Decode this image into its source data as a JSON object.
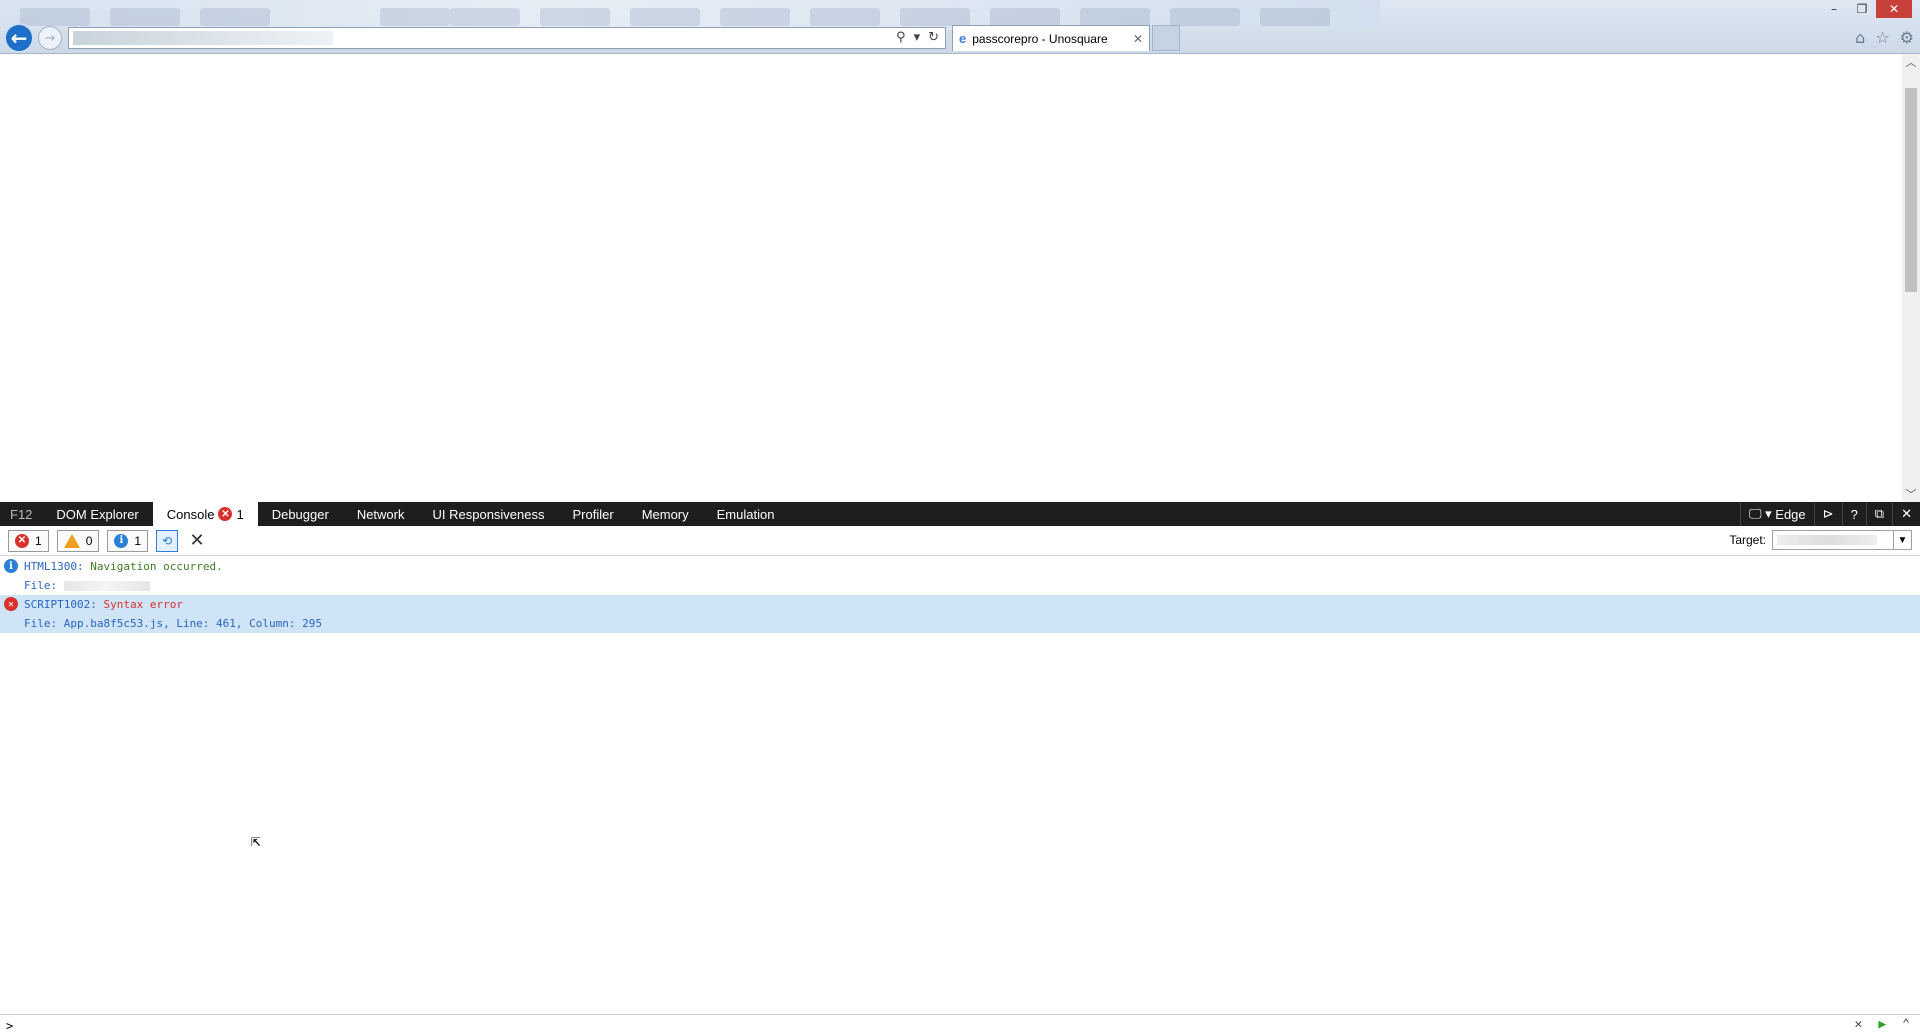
{
  "browser": {
    "tab_title": "passcorepro - Unosquare",
    "window_controls": {
      "minimize": "–",
      "restore": "❐",
      "close": "✕"
    }
  },
  "devtools": {
    "f12_label": "F12",
    "tools": [
      {
        "label": "DOM Explorer"
      },
      {
        "label": "Console",
        "badge": "1"
      },
      {
        "label": "Debugger"
      },
      {
        "label": "Network"
      },
      {
        "label": "UI Responsiveness"
      },
      {
        "label": "Profiler"
      },
      {
        "label": "Memory"
      },
      {
        "label": "Emulation"
      }
    ],
    "mode_label": "Edge",
    "help_label": "?"
  },
  "console": {
    "filters": {
      "errors": "1",
      "warnings": "0",
      "messages": "1"
    },
    "target_label": "Target:",
    "messages": [
      {
        "type": "info",
        "code": "HTML1300:",
        "text": "Navigation occurred.",
        "file_label": "File:"
      },
      {
        "type": "error",
        "code": "SCRIPT1002:",
        "text": "Syntax error",
        "file_label": "File: App.ba8f5c53.js, Line: 461, Column: 295"
      }
    ],
    "prompt": ">"
  },
  "colors": {
    "devbar_bg": "#1e1e1e",
    "error_red": "#d9302c",
    "info_blue": "#2a7fd6",
    "selected_row": "#cfe4f6"
  }
}
